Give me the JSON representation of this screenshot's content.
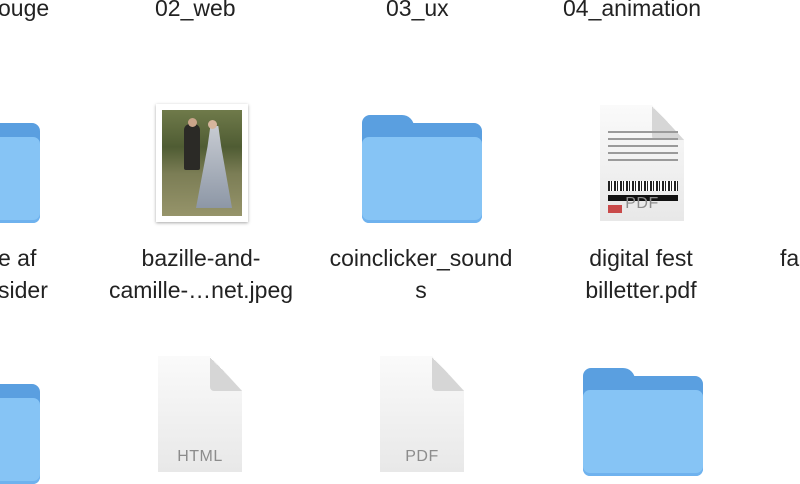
{
  "top_row_labels": [
    "ouge",
    "02_web",
    "03_ux",
    "04_animation"
  ],
  "middle_row": {
    "partial_left": [
      "e af",
      "sider"
    ],
    "items": [
      {
        "name_lines": [
          "bazille-and-",
          "camille-…net.jpeg"
        ],
        "kind": "image"
      },
      {
        "name_lines": [
          "coinclicker_sound",
          "s"
        ],
        "kind": "folder"
      },
      {
        "name_lines": [
          "digital fest",
          "billetter.pdf"
        ],
        "kind": "pdf",
        "tag": "PDF"
      }
    ],
    "partial_right": [
      "fa"
    ]
  },
  "bottom_row": {
    "items": [
      {
        "kind": "html",
        "tag": "HTML"
      },
      {
        "kind": "pdf",
        "tag": "PDF"
      },
      {
        "kind": "folder"
      }
    ]
  },
  "colors": {
    "folder_front": "#86c4f5",
    "folder_back": "#5a9fe0"
  }
}
